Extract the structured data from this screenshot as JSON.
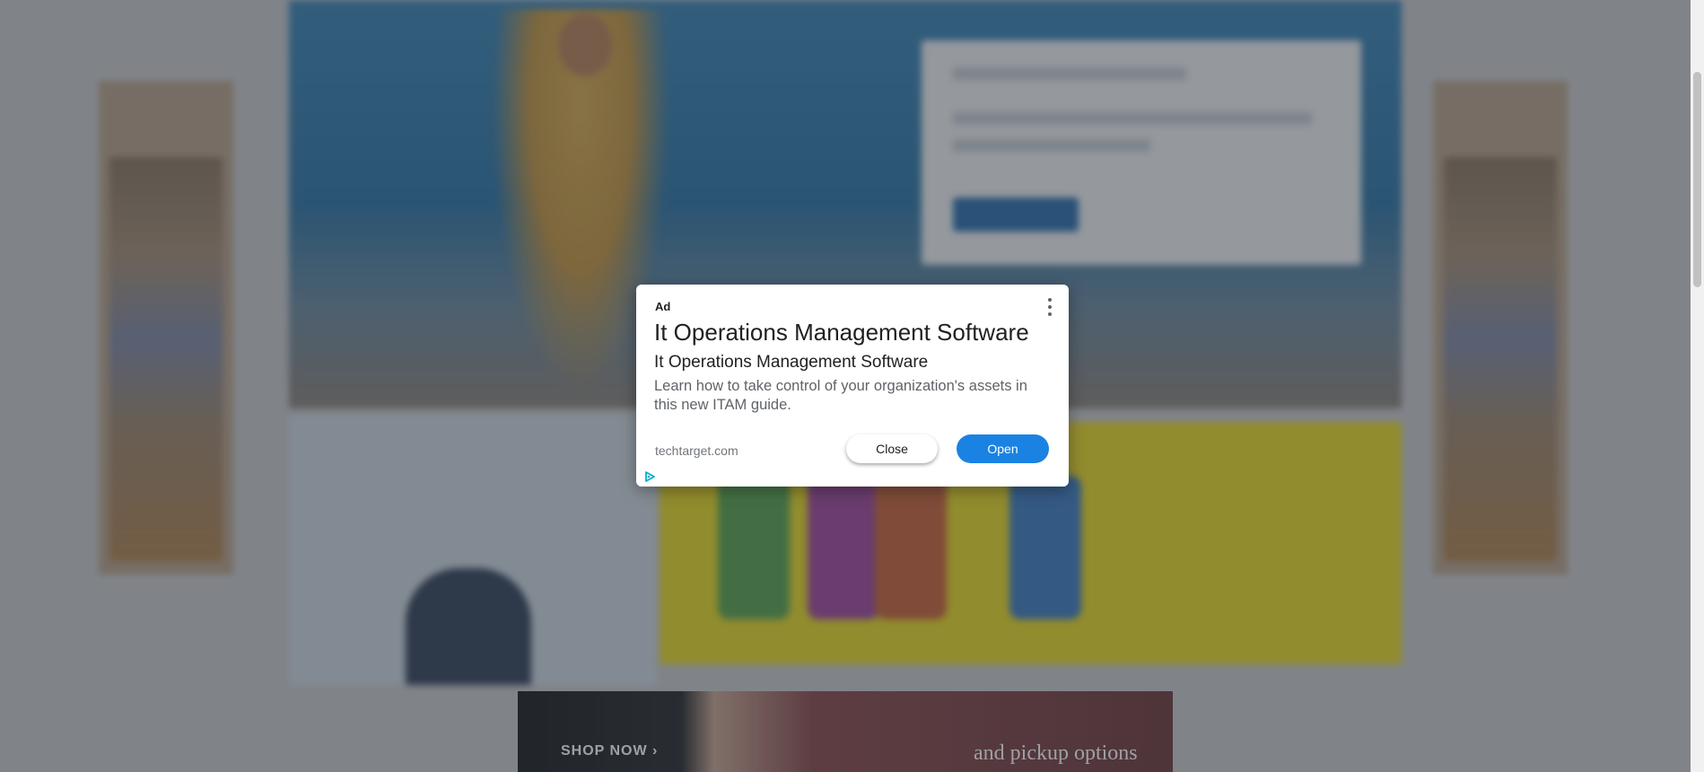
{
  "background": {
    "promo_text": "and pickup options",
    "shop_label": "SHOP NOW ›"
  },
  "ad": {
    "label": "Ad",
    "headline": "It Operations Management Software",
    "subheadline": "It Operations Management Software",
    "description": "Learn how to take control of your organization's assets in this new ITAM guide.",
    "domain": "techtarget.com",
    "close_label": "Close",
    "open_label": "Open",
    "menu_icon": "more-vertical-icon",
    "adchoices_icon": "adchoices-icon"
  },
  "colors": {
    "open_button": "#1a82e2",
    "adchoices": "#00aecd"
  }
}
